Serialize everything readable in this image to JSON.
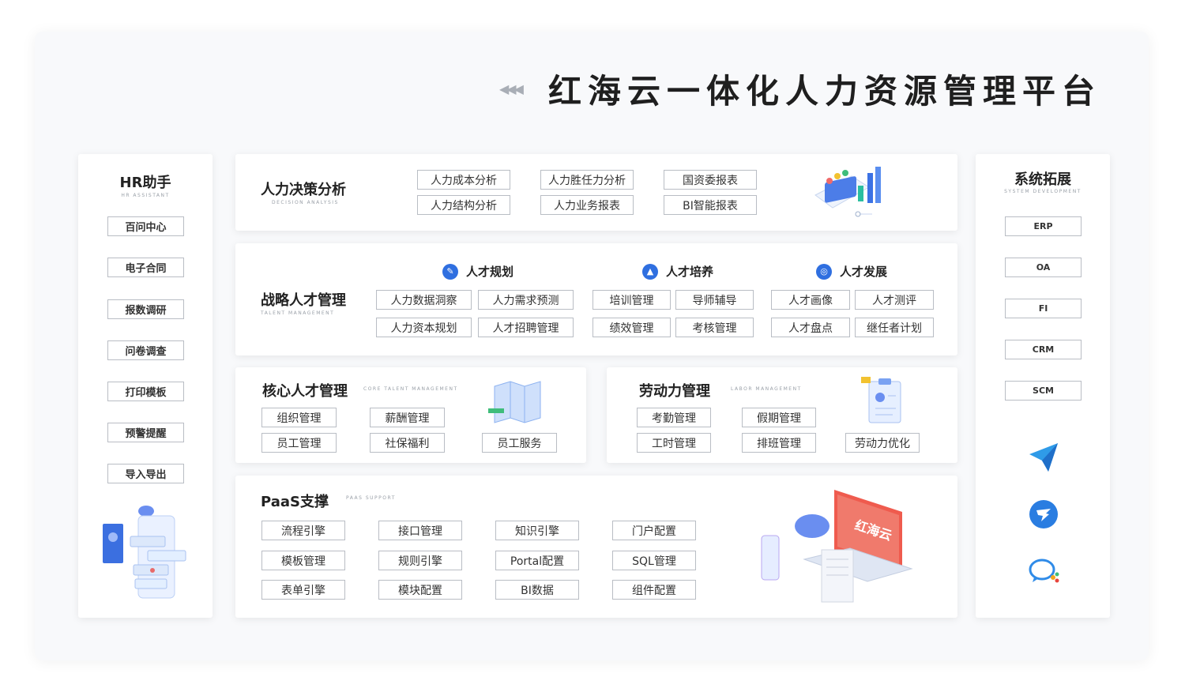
{
  "header": {
    "arrows": "◀◀◀",
    "title": "红海云一体化人力资源管理平台"
  },
  "left_panel": {
    "title": "HR助手",
    "subtitle": "HR ASSISTANT",
    "items": [
      "百问中心",
      "电子合同",
      "报数调研",
      "问卷调查",
      "打印模板",
      "预警提醒",
      "导入导出"
    ]
  },
  "decision": {
    "title": "人力决策分析",
    "subtitle": "DECISION ANALYSIS",
    "items": [
      "人力成本分析",
      "人力胜任力分析",
      "国资委报表",
      "人力结构分析",
      "人力业务报表",
      "BI智能报表"
    ]
  },
  "strategy": {
    "title": "战略人才管理",
    "subtitle": "TALENT MANAGEMENT",
    "groups": [
      {
        "title": "人才规划",
        "icon": "planning-icon",
        "items": [
          "人力数据洞察",
          "人力需求预测",
          "人力资本规划",
          "人才招聘管理"
        ]
      },
      {
        "title": "人才培养",
        "icon": "graduation-cap-icon",
        "items": [
          "培训管理",
          "导师辅导",
          "绩效管理",
          "考核管理"
        ]
      },
      {
        "title": "人才发展",
        "icon": "development-icon",
        "items": [
          "人才画像",
          "人才测评",
          "人才盘点",
          "继任者计划"
        ]
      }
    ]
  },
  "core": {
    "title": "核心人才管理",
    "subtitle": "CORE TALENT MANAGEMENT",
    "items": [
      "组织管理",
      "薪酬管理",
      "员工管理",
      "社保福利",
      "员工服务"
    ]
  },
  "labor": {
    "title": "劳动力管理",
    "subtitle": "LABOR MANAGEMENT",
    "items": [
      "考勤管理",
      "假期管理",
      "工时管理",
      "排班管理",
      "劳动力优化"
    ]
  },
  "paas": {
    "title": "PaaS支撑",
    "subtitle": "PAAS SUPPORT",
    "items": [
      "流程引擎",
      "接口管理",
      "知识引擎",
      "门户配置",
      "模板管理",
      "规则引擎",
      "Portal配置",
      "SQL管理",
      "表单引擎",
      "模块配置",
      "BI数据",
      "组件配置"
    ],
    "brand_mark": "红海云"
  },
  "right_panel": {
    "title": "系统拓展",
    "subtitle": "SYSTEM DEVELOPMENT",
    "items": [
      "ERP",
      "OA",
      "FI",
      "CRM",
      "SCM"
    ],
    "apps": [
      "paper-plane-icon",
      "dingtalk-icon",
      "wecom-icon"
    ]
  },
  "colors": {
    "accent_blue": "#2f6fe0",
    "brand_red": "#e8453c",
    "border": "#b9bdc4"
  }
}
